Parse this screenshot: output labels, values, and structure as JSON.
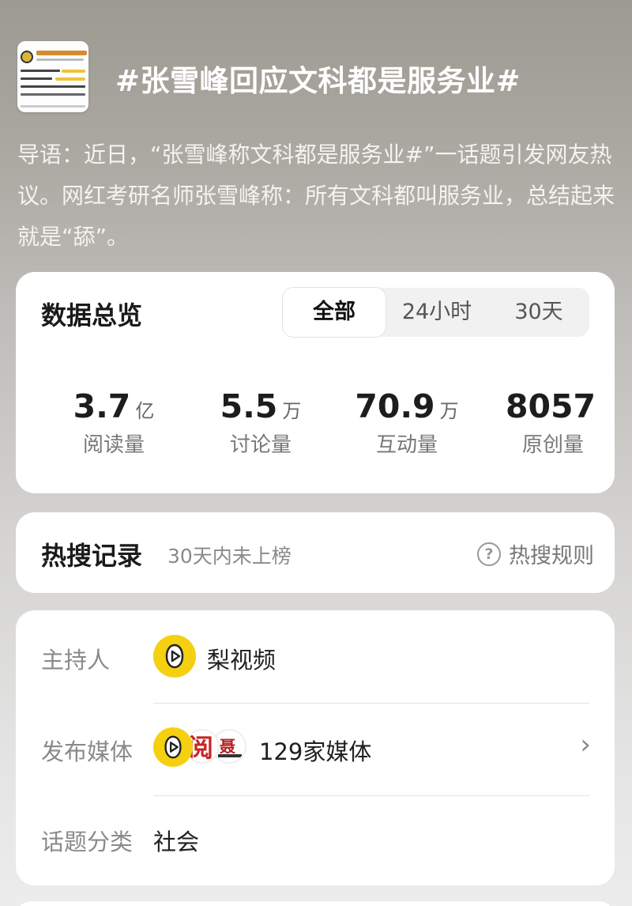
{
  "topic": {
    "title": "#张雪峰回应文科都是服务业#",
    "intro": "导语：近日，“张雪峰称文科都是服务业#”一话题引发网友热议。网红考研名师张雪峰称：所有文科都叫服务业，总结起来就是“舔”。"
  },
  "overview": {
    "title": "数据总览",
    "tabs": [
      "全部",
      "24小时",
      "30天"
    ],
    "active_tab": "全部",
    "stats": [
      {
        "value": "3.7",
        "unit": "亿",
        "label": "阅读量"
      },
      {
        "value": "5.5",
        "unit": "万",
        "label": "讨论量"
      },
      {
        "value": "70.9",
        "unit": "万",
        "label": "互动量"
      },
      {
        "value": "8057",
        "unit": "",
        "label": "原创量"
      }
    ]
  },
  "hot_search": {
    "title": "热搜记录",
    "status": "30天内未上榜",
    "rules_label": "热搜规则"
  },
  "info": {
    "host_key": "主持人",
    "host_value": "梨视频",
    "media_key": "发布媒体",
    "media_value": "129家媒体",
    "category_key": "话题分类",
    "category_value": "社会"
  },
  "icons": {
    "help": "question-circle-icon",
    "chevron": "chevron-right-icon",
    "host_logo": "pear-video-logo"
  }
}
